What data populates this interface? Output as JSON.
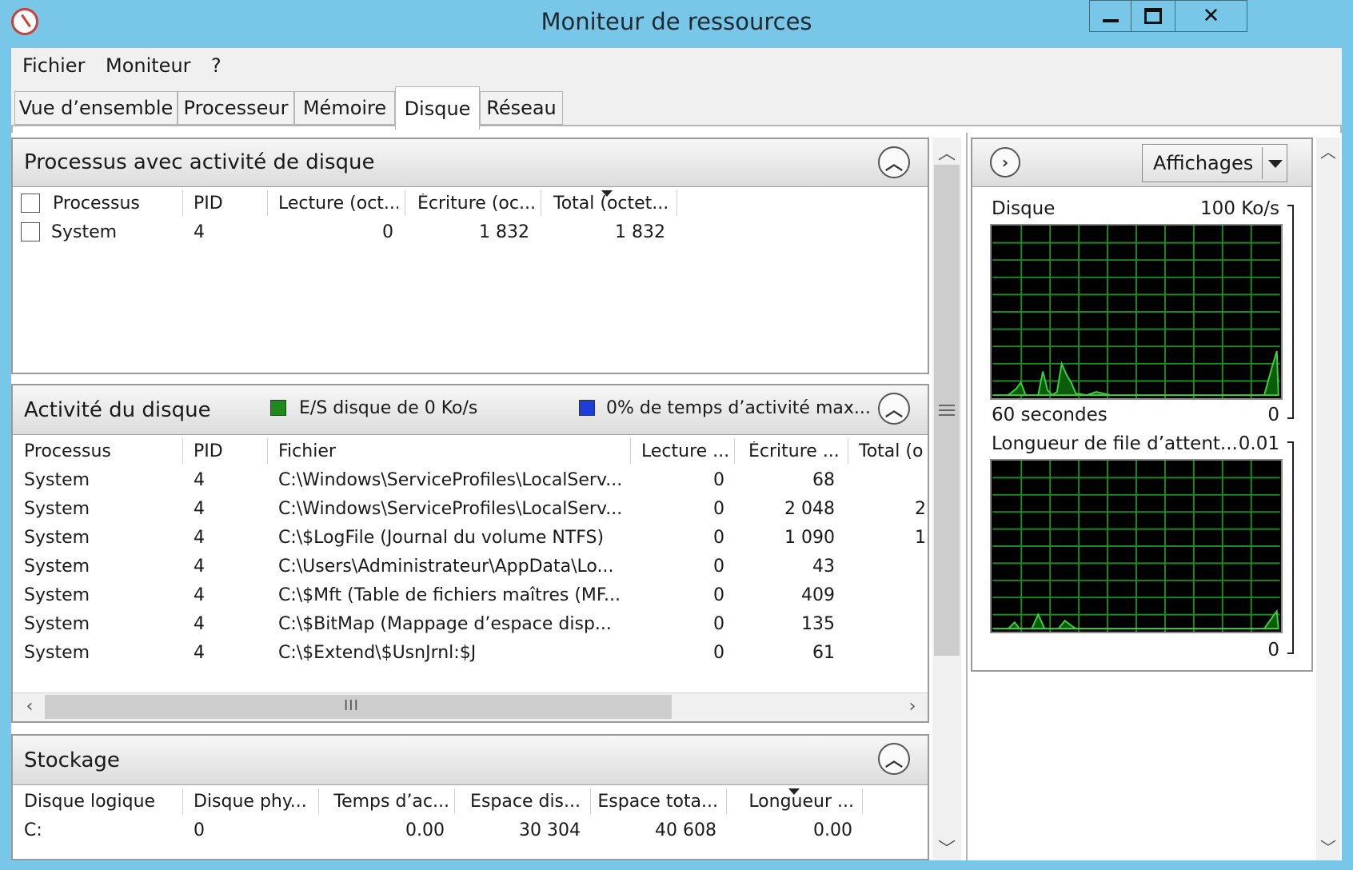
{
  "window": {
    "title": "Moniteur de ressources",
    "min_glyph": "▁",
    "max_glyph": "◻",
    "close_glyph": "✕"
  },
  "menu": [
    "Fichier",
    "Moniteur",
    "?"
  ],
  "tabs": [
    "Vue d’ensemble",
    "Processeur",
    "Mémoire",
    "Disque",
    "Réseau"
  ],
  "active_tab": "Disque",
  "proc_section": {
    "title": "Processus avec activité de disque",
    "columns": [
      "Processus",
      "PID",
      "Lecture (oct...",
      "Écriture (oc...",
      "Total (octet..."
    ],
    "rows": [
      {
        "name": "System",
        "pid": "4",
        "read": "0",
        "write": "1 832",
        "total": "1 832"
      }
    ]
  },
  "disk_section": {
    "title": "Activité du disque",
    "legend_io": "E/S disque de 0 Ko/s",
    "legend_active": "0% de temps d’activité max...",
    "io_color": "#1e8a1e",
    "active_color": "#1c3fd8",
    "columns": [
      "Processus",
      "PID",
      "Fichier",
      "Lecture ...",
      "Écriture ...",
      "Total (o"
    ],
    "rows": [
      {
        "name": "System",
        "pid": "4",
        "file": "C:\\Windows\\ServiceProfiles\\LocalServ...",
        "read": "0",
        "write": "68",
        "total": ""
      },
      {
        "name": "System",
        "pid": "4",
        "file": "C:\\Windows\\ServiceProfiles\\LocalServ...",
        "read": "0",
        "write": "2 048",
        "total": "2"
      },
      {
        "name": "System",
        "pid": "4",
        "file": "C:\\$LogFile (Journal du volume NTFS)",
        "read": "0",
        "write": "1 090",
        "total": "1"
      },
      {
        "name": "System",
        "pid": "4",
        "file": "C:\\Users\\Administrateur\\AppData\\Lo...",
        "read": "0",
        "write": "43",
        "total": ""
      },
      {
        "name": "System",
        "pid": "4",
        "file": "C:\\$Mft (Table de fichiers maîtres (MF...",
        "read": "0",
        "write": "409",
        "total": ""
      },
      {
        "name": "System",
        "pid": "4",
        "file": "C:\\$BitMap (Mappage d’espace disp...",
        "read": "0",
        "write": "135",
        "total": ""
      },
      {
        "name": "System",
        "pid": "4",
        "file": "C:\\$Extend\\$UsnJrnl:$J",
        "read": "0",
        "write": "61",
        "total": ""
      }
    ],
    "hscroll_grip": "III"
  },
  "storage_section": {
    "title": "Stockage",
    "columns": [
      "Disque logique",
      "Disque phy...",
      "Temps d’ac...",
      "Espace dis...",
      "Espace tota...",
      "Longueur ..."
    ],
    "rows": [
      {
        "logical": "C:",
        "physical": "0",
        "active": "0.00",
        "free": "30 304",
        "total": "40 608",
        "queue": "0.00"
      }
    ]
  },
  "right_panel": {
    "views_label": "Affichages",
    "graph_disk": {
      "label": "Disque",
      "max": "100 Ko/s",
      "time": "60 secondes",
      "min": "0"
    },
    "graph_queue": {
      "label": "Longueur de file d’attent...",
      "max": "0.01",
      "min": "0"
    },
    "line_color": "#3ad13a",
    "grid_color": "#1f8a1f"
  }
}
